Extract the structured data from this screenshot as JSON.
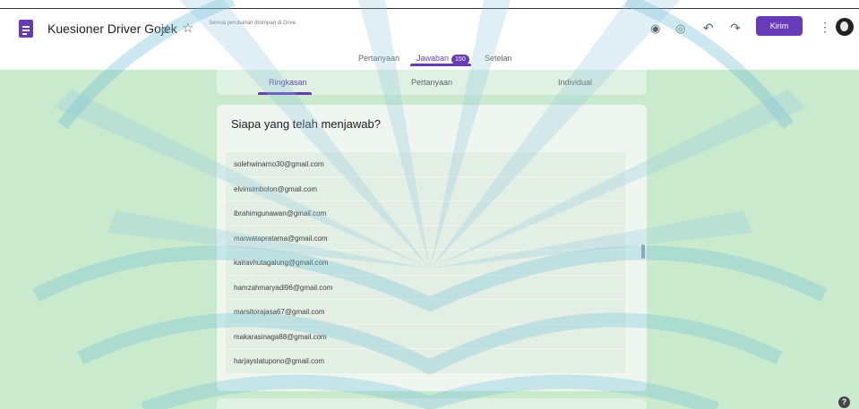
{
  "header": {
    "doc_title": "Kuesioner Driver Gojek",
    "save_status": "Semua perubahan disimpan di Drive",
    "send_label": "Kirim"
  },
  "tabs": [
    {
      "label": "Pertanyaan"
    },
    {
      "label": "Jawaban",
      "badge": "150"
    },
    {
      "label": "Setelan"
    }
  ],
  "subtabs": [
    {
      "label": "Ringkasan"
    },
    {
      "label": "Pertanyaan"
    },
    {
      "label": "Individual"
    }
  ],
  "card": {
    "title": "Siapa yang telah menjawab?"
  },
  "emails": [
    "solehwinarno30@gmail.com",
    "elvinsimbolon@gmail.com",
    "ibrahimgunawan@gmail.com",
    "marwatapratama@gmail.com",
    "kairavhutagalung@gmail.com",
    "hamzahmaryadi96@gmail.com",
    "marsitorajasa67@gmail.com",
    "makarasinaga88@gmail.com",
    "harjayslatupono@gmail.com"
  ],
  "help_label": "?",
  "icons": {
    "forms": "forms-icon",
    "add_collaborator": "add-collaborator-icon",
    "star": "star-icon",
    "palette": "palette-icon",
    "preview": "eye-icon",
    "undo": "undo-icon",
    "redo": "redo-icon",
    "more": "more-vert-icon"
  },
  "colors": {
    "accent": "#673ab7",
    "background": "#c9eacd"
  }
}
